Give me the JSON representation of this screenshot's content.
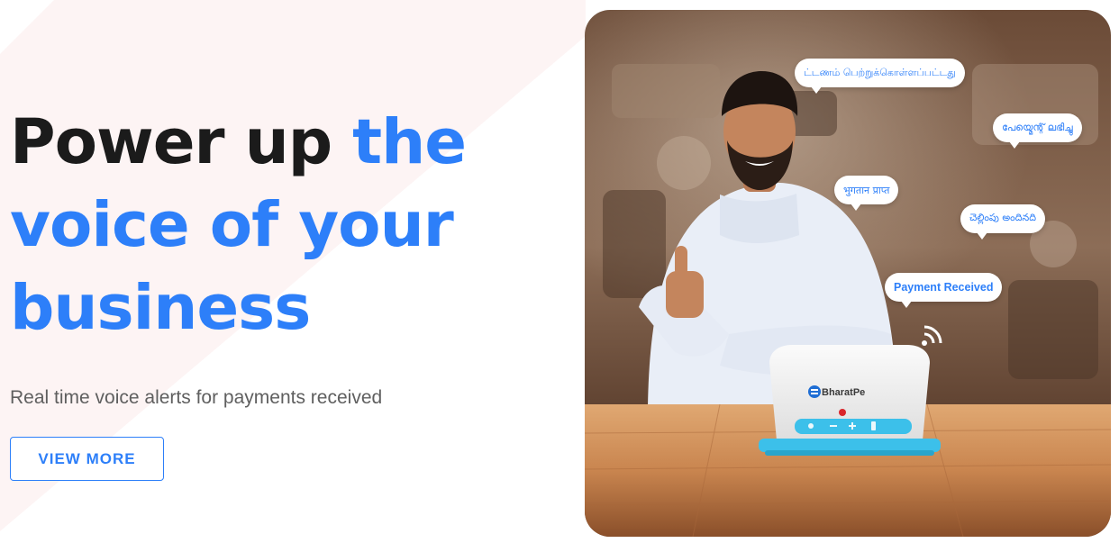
{
  "hero": {
    "title_dark": "Power up ",
    "title_accent_1": "the",
    "title_accent_2": "voice of your",
    "title_accent_3": "business",
    "subtitle": "Real time voice alerts for payments received",
    "cta_label": "VIEW MORE"
  },
  "image": {
    "bubbles": {
      "tamil": "ட்டணம் பெற்றுக்கொள்ளப்பட்டது",
      "malayalam": "പേയ്മെന്റ് ലഭിച്ചു",
      "hindi": "भुगतान प्राप्त",
      "telugu": "చెల్లింపు అందినది",
      "english": "Payment Received"
    },
    "device_brand": "BharatPe",
    "icons": [
      "wifi-signal-icon",
      "bharatpe-logo-icon",
      "volume-icon",
      "minus-icon",
      "plus-icon",
      "battery-icon"
    ]
  },
  "colors": {
    "accent": "#2d7ff9",
    "headline": "#1b1b1b",
    "subtitle": "#5f5f5f",
    "device_accent": "#3cc0ea"
  }
}
